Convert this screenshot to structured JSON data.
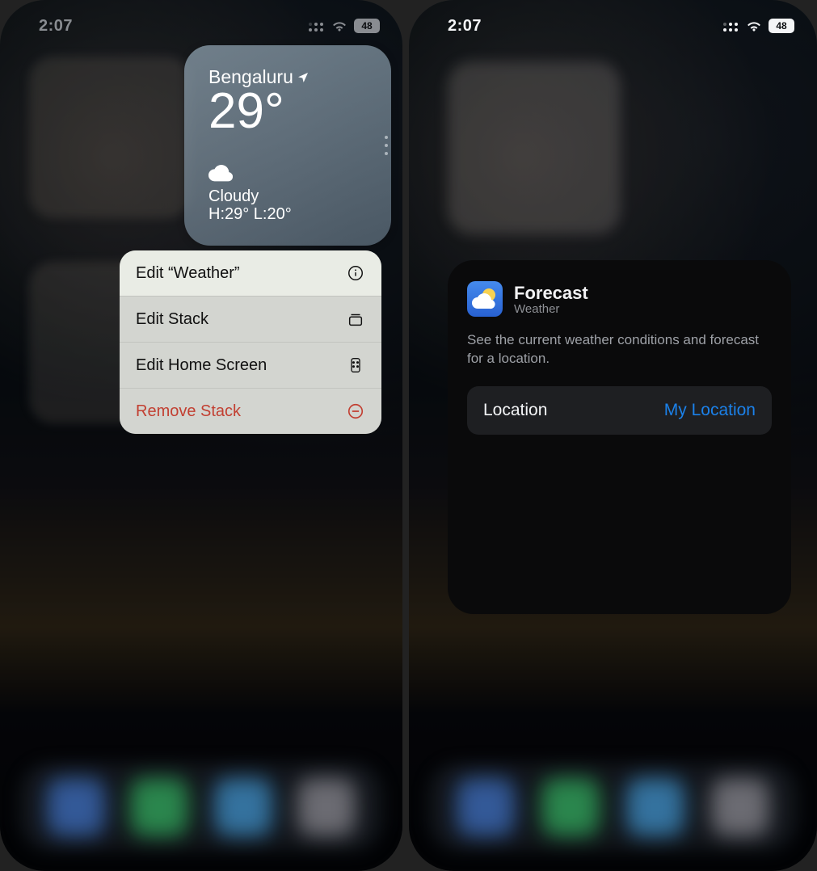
{
  "status": {
    "time": "2:07",
    "battery": "48"
  },
  "weather_widget": {
    "city": "Bengaluru",
    "temp": "29°",
    "condition": "Cloudy",
    "high_low": "H:29° L:20°"
  },
  "context_menu": {
    "edit_weather": "Edit “Weather”",
    "edit_stack": "Edit Stack",
    "edit_home": "Edit Home Screen",
    "remove_stack": "Remove Stack"
  },
  "sheet": {
    "title": "Forecast",
    "subtitle": "Weather",
    "description": "See the current weather conditions and forecast for a location.",
    "location_label": "Location",
    "location_value": "My Location"
  }
}
